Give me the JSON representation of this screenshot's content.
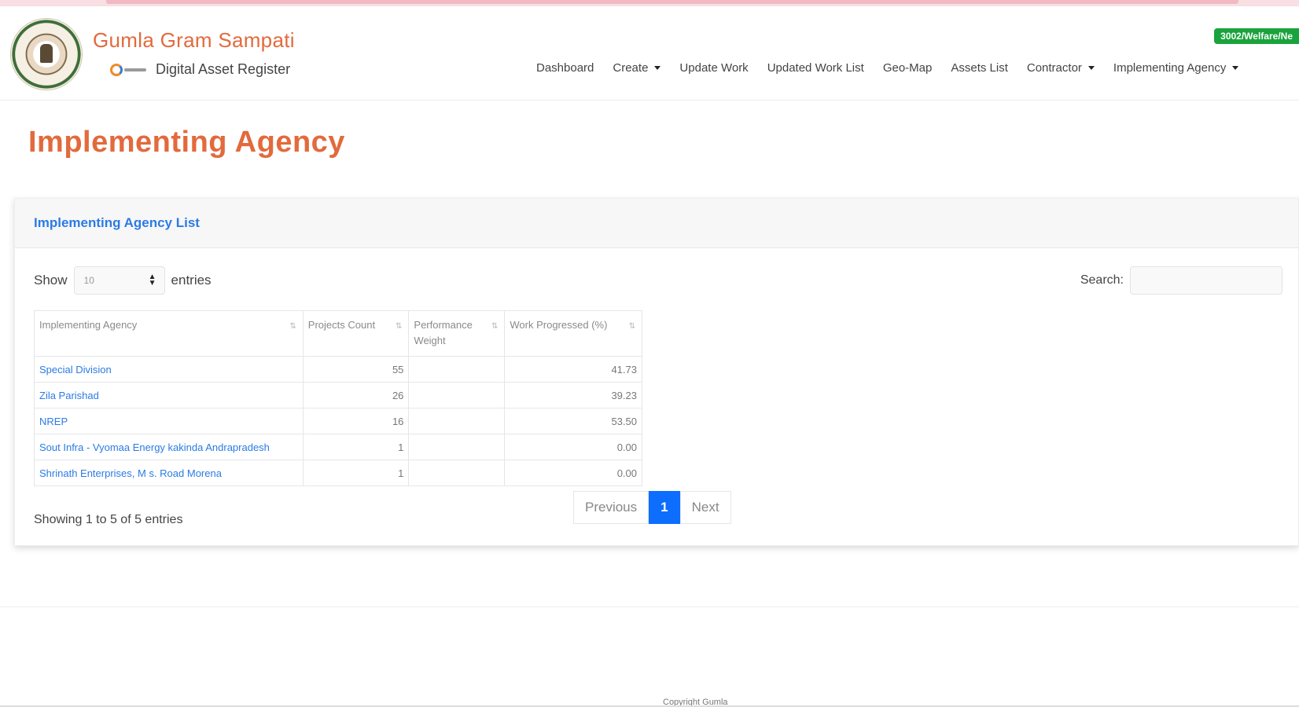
{
  "brand": {
    "title": "Gumla Gram Sampati",
    "subtitle": "Digital Asset Register",
    "badge": "3002/Welfare/Ne"
  },
  "nav": {
    "items": [
      {
        "label": "Dashboard",
        "dropdown": false
      },
      {
        "label": "Create",
        "dropdown": true
      },
      {
        "label": "Update Work",
        "dropdown": false
      },
      {
        "label": "Updated Work List",
        "dropdown": false
      },
      {
        "label": "Geo-Map",
        "dropdown": false
      },
      {
        "label": "Assets List",
        "dropdown": false
      },
      {
        "label": "Contractor",
        "dropdown": true
      },
      {
        "label": "Implementing Agency",
        "dropdown": true
      }
    ]
  },
  "page": {
    "title": "Implementing Agency"
  },
  "card": {
    "title": "Implementing Agency List",
    "show_label": "Show",
    "entries_label": "entries",
    "page_size": "10",
    "search_label": "Search:",
    "search_value": ""
  },
  "table": {
    "headers": [
      "Implementing Agency",
      "Projects Count",
      "Performance Weight",
      "Work Progressed (%)"
    ],
    "rows": [
      {
        "agency": "Special Division",
        "projects": "55",
        "weight": "",
        "progress": "41.73"
      },
      {
        "agency": "Zila Parishad",
        "projects": "26",
        "weight": "",
        "progress": "39.23"
      },
      {
        "agency": "NREP",
        "projects": "16",
        "weight": "",
        "progress": "53.50"
      },
      {
        "agency": "Sout Infra - Vyomaa Energy kakinda Andrapradesh",
        "projects": "1",
        "weight": "",
        "progress": "0.00"
      },
      {
        "agency": "Shrinath Enterprises, M s. Road Morena",
        "projects": "1",
        "weight": "",
        "progress": "0.00"
      }
    ]
  },
  "pagination": {
    "info": "Showing 1 to 5 of 5 entries",
    "previous": "Previous",
    "current": "1",
    "next": "Next"
  },
  "footer": {
    "text": "Copyright Gumla"
  },
  "colors": {
    "brand": "#e26a3c",
    "link": "#2b7be4",
    "active_page": "#0d6efd",
    "badge": "#1aa33c"
  }
}
